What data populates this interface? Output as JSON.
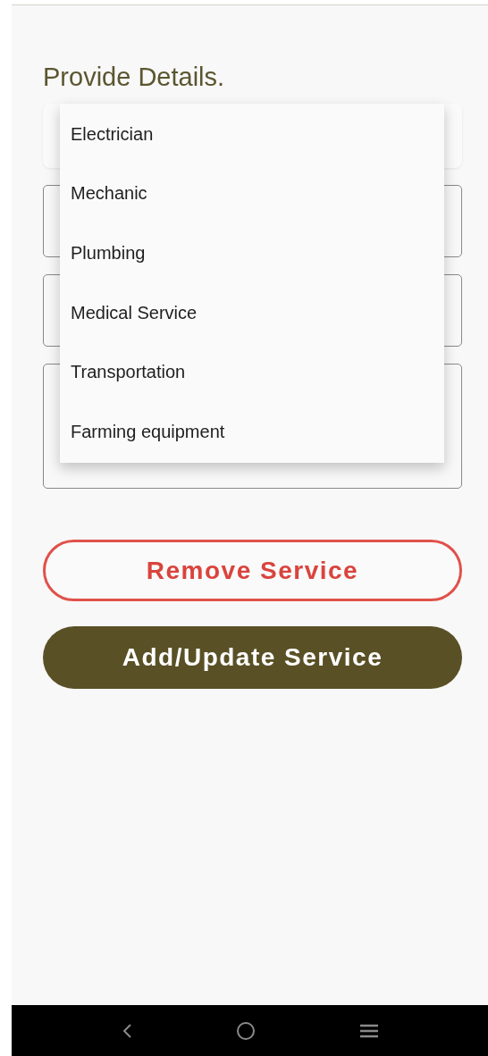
{
  "title": "Provide Details.",
  "fields": [
    {
      "kind": "dropdown"
    },
    {
      "kind": "outlined"
    },
    {
      "kind": "outlined"
    },
    {
      "kind": "multiline"
    }
  ],
  "menu": {
    "items": [
      {
        "label": "Electrician"
      },
      {
        "label": "Mechanic"
      },
      {
        "label": "Plumbing"
      },
      {
        "label": "Medical Service"
      },
      {
        "label": "Transportation"
      },
      {
        "label": "Farming equipment"
      }
    ]
  },
  "buttons": [
    {
      "label": "Remove Service",
      "kind": "outline"
    },
    {
      "label": "Add/Update Service",
      "kind": "filled"
    }
  ],
  "nav_bar": [
    {
      "kind": "back"
    },
    {
      "kind": "home"
    },
    {
      "kind": "recents"
    }
  ]
}
